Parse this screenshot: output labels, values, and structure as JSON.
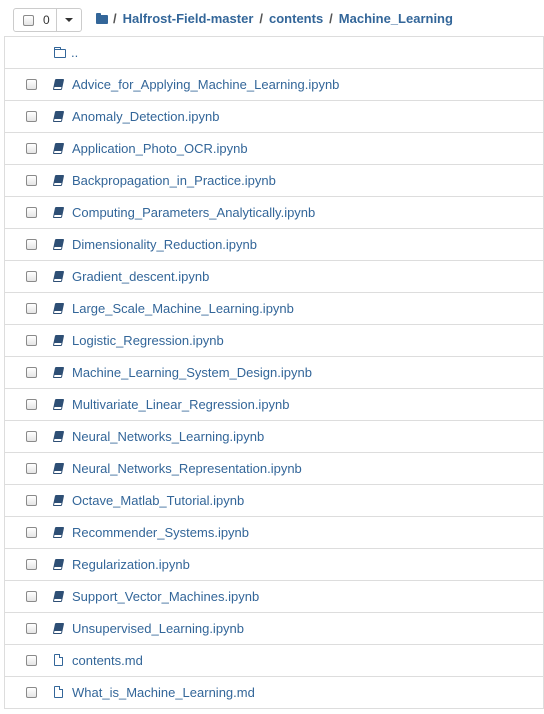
{
  "toolbar": {
    "selected_count": "0"
  },
  "breadcrumb": {
    "root_sep": "/",
    "items": [
      {
        "label": "Halfrost-Field-master",
        "sep": "/"
      },
      {
        "label": "contents",
        "sep": "/"
      },
      {
        "label": "Machine_Learning",
        "sep": ""
      }
    ]
  },
  "list": {
    "parent_label": "..",
    "items": [
      {
        "name": "Advice_for_Applying_Machine_Learning.ipynb",
        "icon": "notebook-icon"
      },
      {
        "name": "Anomaly_Detection.ipynb",
        "icon": "notebook-icon"
      },
      {
        "name": "Application_Photo_OCR.ipynb",
        "icon": "notebook-icon"
      },
      {
        "name": "Backpropagation_in_Practice.ipynb",
        "icon": "notebook-icon"
      },
      {
        "name": "Computing_Parameters_Analytically.ipynb",
        "icon": "notebook-icon"
      },
      {
        "name": "Dimensionality_Reduction.ipynb",
        "icon": "notebook-icon"
      },
      {
        "name": "Gradient_descent.ipynb",
        "icon": "notebook-icon"
      },
      {
        "name": "Large_Scale_Machine_Learning.ipynb",
        "icon": "notebook-icon"
      },
      {
        "name": "Logistic_Regression.ipynb",
        "icon": "notebook-icon"
      },
      {
        "name": "Machine_Learning_System_Design.ipynb",
        "icon": "notebook-icon"
      },
      {
        "name": "Multivariate_Linear_Regression.ipynb",
        "icon": "notebook-icon"
      },
      {
        "name": "Neural_Networks_Learning.ipynb",
        "icon": "notebook-icon"
      },
      {
        "name": "Neural_Networks_Representation.ipynb",
        "icon": "notebook-icon"
      },
      {
        "name": "Octave_Matlab_Tutorial.ipynb",
        "icon": "notebook-icon"
      },
      {
        "name": "Recommender_Systems.ipynb",
        "icon": "notebook-icon"
      },
      {
        "name": "Regularization.ipynb",
        "icon": "notebook-icon"
      },
      {
        "name": "Support_Vector_Machines.ipynb",
        "icon": "notebook-icon"
      },
      {
        "name": "Unsupervised_Learning.ipynb",
        "icon": "notebook-icon"
      },
      {
        "name": "contents.md",
        "icon": "file-icon"
      },
      {
        "name": "What_is_Machine_Learning.md",
        "icon": "file-icon"
      }
    ]
  },
  "colors": {
    "link": "#336699",
    "border": "#dddddd"
  }
}
